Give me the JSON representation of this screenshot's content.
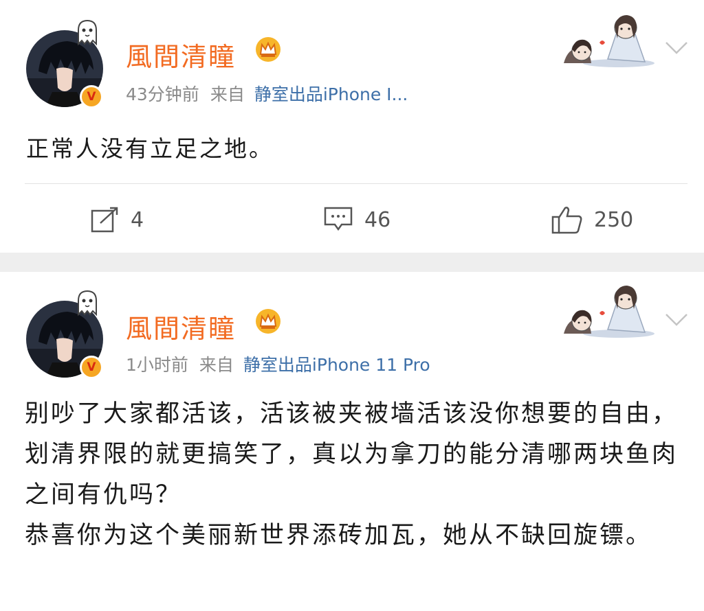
{
  "posts": [
    {
      "username": "風間清瞳",
      "time": "43分钟前",
      "source_prefix": "来自",
      "source": "静室出品iPhone I...",
      "text": "正常人没有立足之地。",
      "repost_count": "4",
      "comment_count": "46",
      "like_count": "250"
    },
    {
      "username": "風間清瞳",
      "time": "1小时前",
      "source_prefix": "来自",
      "source": "静室出品iPhone 11 Pro",
      "text": "别吵了大家都活该，活该被夹被墙活该没你想要的自由，划清界限的就更搞笑了，真以为拿刀的能分清哪两块鱼肉之间有仇吗？\n恭喜你为这个美丽新世界添砖加瓦，她从不缺回旋镖。"
    }
  ],
  "icons": {
    "badge": "verified-badge",
    "crown": "crown-icon",
    "ghost": "ghost-icon",
    "chevron": "chevron-down-icon",
    "repost": "repost-icon",
    "comment": "comment-icon",
    "like": "like-icon"
  },
  "colors": {
    "username": "#f26b22",
    "source_link": "#3d6fa8",
    "meta": "#8a8a8a",
    "separator": "#eeeeee"
  }
}
